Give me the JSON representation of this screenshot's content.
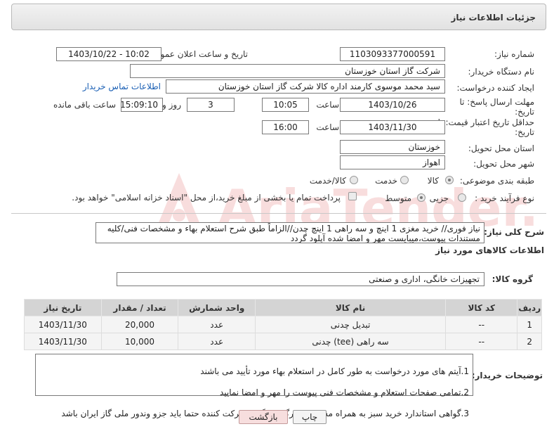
{
  "header": {
    "title": "جزئیات اطلاعات نیاز"
  },
  "form": {
    "need_number": {
      "label": "شماره نیاز:",
      "value": "1103093377000591"
    },
    "announce_datetime": {
      "label": "تاریخ و ساعت اعلان عمومی:",
      "value": "1403/10/22 - 10:02"
    },
    "buyer_org": {
      "label": "نام دستگاه خریدار:",
      "value": "شرکت گاز استان خوزستان"
    },
    "requester": {
      "label": "ایجاد کننده درخواست:",
      "value": "سید محمد موسوی کارمند اداره کالا شرکت گاز استان خوزستان",
      "contact_link": "اطلاعات تماس خریدار"
    },
    "reply_deadline": {
      "label_line1": "مهلت ارسال پاسخ: تا",
      "label_line2": "تاریخ:",
      "date": "1403/10/26",
      "time_label": "ساعت",
      "time": "10:05",
      "days": "3",
      "days_label": "روز و",
      "remaining": "15:09:10",
      "remaining_label": "ساعت باقی مانده"
    },
    "price_validity": {
      "label_line1": "حداقل تاریخ اعتبار قیمت: تا",
      "label_line2": "تاریخ:",
      "date": "1403/11/30",
      "time_label": "ساعت",
      "time": "16:00"
    },
    "delivery_province": {
      "label": "استان محل تحویل:",
      "value": "خوزستان"
    },
    "delivery_city": {
      "label": "شهر محل تحویل:",
      "value": "اهواز"
    },
    "category": {
      "label": "طبقه بندی موضوعی:",
      "options": [
        "کالا",
        "خدمت",
        "کالا/خدمت"
      ],
      "selected": "کالا"
    },
    "purchase_type": {
      "label": "نوع فرآیند خرید :",
      "options": [
        "جزیی",
        "متوسط"
      ],
      "selected": "جزیی",
      "payment_note": "پرداخت تمام یا بخشی از مبلغ خرید،از محل \"اسناد خزانه اسلامی\" خواهد بود."
    }
  },
  "description": {
    "label": "شرح کلی نیاز:",
    "text": "نیاز فوری// خرید مغزی 1 اینچ و سه راهی 1 اینچ چدن//الزاماً طبق شرح استعلام بهاء و مشخصات فنی/کلیه مستندات پیوست،میبایست مهر و امضا شده آپلود گردد"
  },
  "goods_section": {
    "title": "اطلاعات کالاهای مورد نیاز",
    "group_label": "گروه کالا:",
    "group_value": "تجهیزات خانگی، اداری و صنعتی"
  },
  "table": {
    "columns": [
      "ردیف",
      "کد کالا",
      "نام کالا",
      "واحد شمارش",
      "تعداد / مقدار",
      "تاریخ نیاز"
    ],
    "rows": [
      [
        "1",
        "--",
        "تبدیل چدنی",
        "عدد",
        "20,000",
        "1403/11/30"
      ],
      [
        "2",
        "--",
        "سه راهی (tee) چدنی",
        "عدد",
        "10,000",
        "1403/11/30"
      ]
    ]
  },
  "buyer_notes": {
    "label": "توضیحات خریدار:",
    "lines": [
      "1.آیتم های مورد درخواست به طور کامل در استعلام بهاء مورد تأیید می باشند",
      "2.تمامی صفحات استعلام و مشخصات فنی پیوست را مهر و امضا نمایید",
      "3.گواهی استاندارد خرید سبز به همراه مستندات بارگذاری گردد.شرکت کننده حتما باید جزو وندور ملی گاز ایران باشد"
    ]
  },
  "buttons": {
    "print": "چاپ",
    "back": "بازگشت"
  },
  "watermark": {
    "brand": "AriaTender.net"
  }
}
